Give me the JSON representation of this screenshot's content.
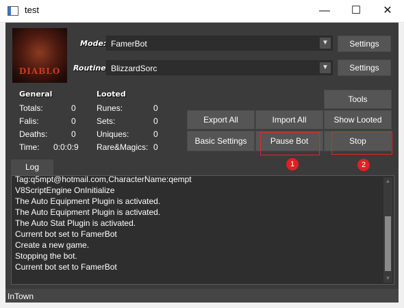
{
  "window": {
    "title": "test",
    "minimize": "—",
    "maximize": "☐",
    "close": "✕"
  },
  "logo": {
    "text": "DIABLO"
  },
  "mode": {
    "label": "Mode:",
    "value": "FamerBot",
    "settings_label": "Settings"
  },
  "routine": {
    "label": "Routine:",
    "value": "BlizzardSorc",
    "settings_label": "Settings"
  },
  "general": {
    "header": "General",
    "rows": [
      {
        "label": "Totals:",
        "value": "0"
      },
      {
        "label": "Falis:",
        "value": "0"
      },
      {
        "label": "Deaths:",
        "value": "0"
      },
      {
        "label": "Time:",
        "value": "0:0:0:9"
      }
    ]
  },
  "looted": {
    "header": "Looted",
    "rows": [
      {
        "label": "Runes:",
        "value": "0"
      },
      {
        "label": "Sets:",
        "value": "0"
      },
      {
        "label": "Uniques:",
        "value": "0"
      },
      {
        "label": "Rare&Magics:",
        "value": "0"
      }
    ]
  },
  "buttons": {
    "tools": "Tools",
    "export_all": "Export All",
    "import_all": "Import All",
    "show_looted": "Show Looted",
    "basic_settings": "Basic Settings",
    "pause_bot": "Pause Bot",
    "stop": "Stop"
  },
  "annotations": {
    "badge1": "1",
    "badge2": "2"
  },
  "log": {
    "tab_label": "Log",
    "lines": [
      "Tag:q5mpt@hotmail.com,CharacterName:qempt",
      "V8ScriptEngine OnInitialize",
      "The Auto Equipment Plugin is activated.",
      "The Auto Equipment Plugin is activated.",
      "The Auto Stat Plugin is activated.",
      "Current bot set to FamerBot",
      "Create a new game.",
      "Stopping the bot.",
      "Current bot set to FamerBot"
    ]
  },
  "status": {
    "text": "InTown"
  },
  "colors": {
    "accent_red": "#e2262f",
    "panel": "#3b3b3b",
    "button": "#555555"
  }
}
